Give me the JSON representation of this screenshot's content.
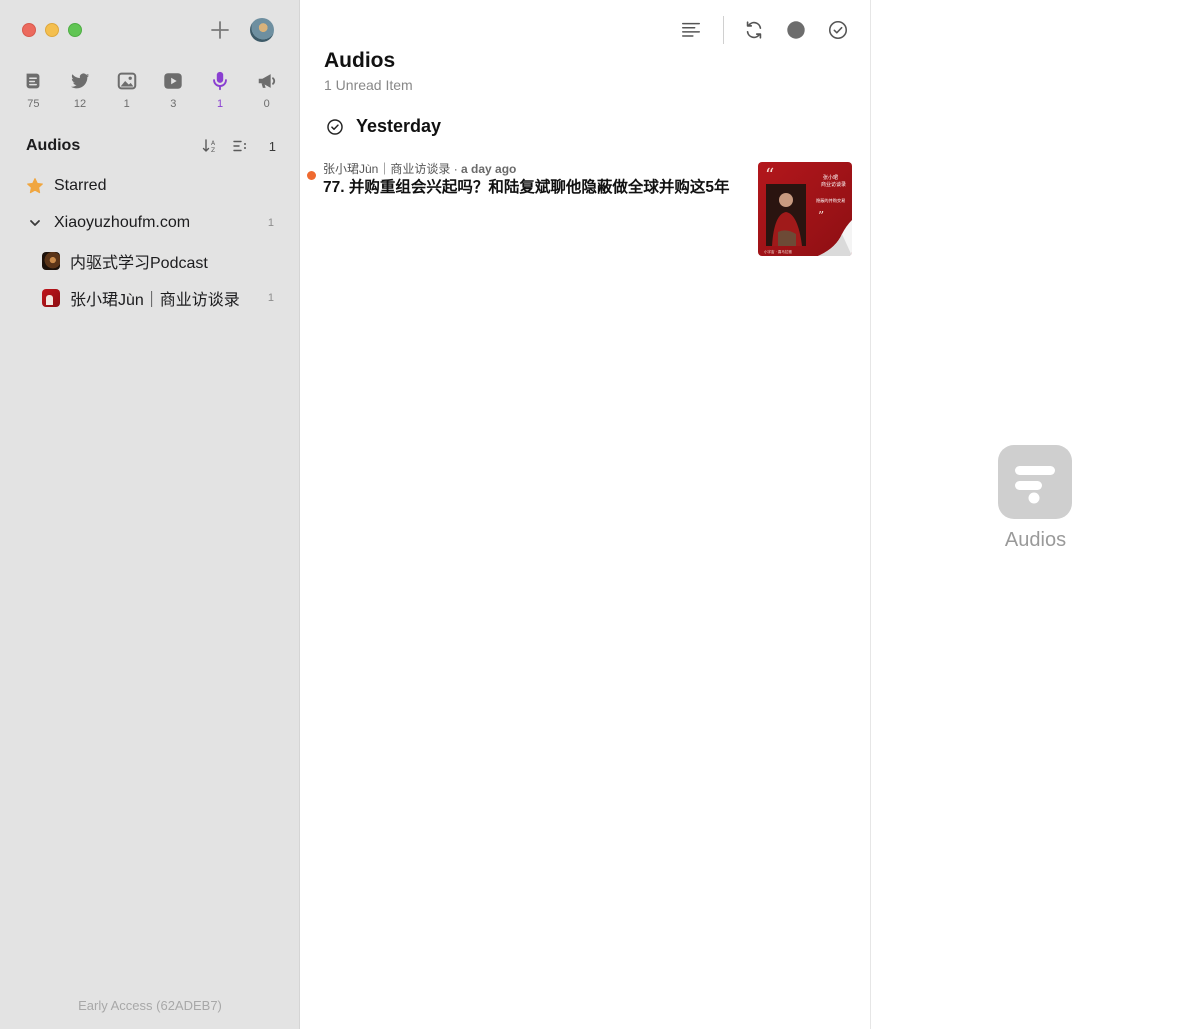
{
  "sidebar": {
    "type_filters": [
      {
        "icon": "rss-scroll-icon",
        "count": "75"
      },
      {
        "icon": "twitter-bird-icon",
        "count": "12"
      },
      {
        "icon": "image-icon",
        "count": "1"
      },
      {
        "icon": "video-play-icon",
        "count": "3"
      },
      {
        "icon": "microphone-icon",
        "count": "1",
        "active": true
      },
      {
        "icon": "megaphone-icon",
        "count": "0"
      }
    ],
    "section_title": "Audios",
    "section_count": "1",
    "starred_label": "Starred",
    "folder": {
      "label": "Xiaoyuzhoufm.com",
      "count": "1"
    },
    "feeds": [
      {
        "label": "内驱式学习Podcast",
        "count": ""
      },
      {
        "label": "张小珺Jùn｜商业访谈录",
        "count": "1"
      }
    ],
    "footer": "Early Access (62ADEB7)",
    "active_color": "#8a3fd1"
  },
  "list": {
    "title": "Audios",
    "subtitle": "1 Unread Item",
    "group_label": "Yesterday",
    "articles": [
      {
        "source": "张小珺Jùn｜商业访谈录",
        "separator": " · ",
        "time": "a day ago",
        "title": "77. 并购重组会兴起吗？和陆复斌聊他隐蔽做全球并购这5年",
        "thumb_text_top": "张小珺\n商业访谈录",
        "thumb_text_mid": "隐蔽的并购交易",
        "thumb_num": "077",
        "unread_color": "#ef6a30"
      }
    ]
  },
  "detail": {
    "empty_label": "Audios"
  }
}
